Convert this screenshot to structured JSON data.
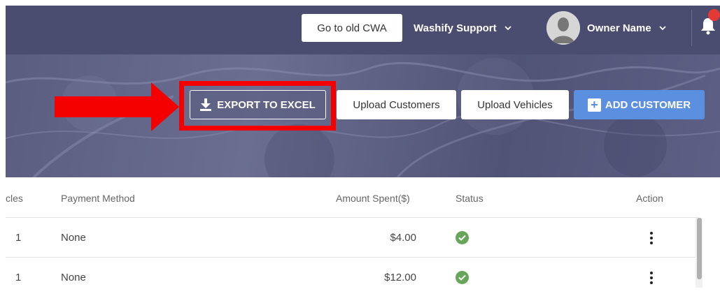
{
  "header": {
    "old_cwa_label": "Go to old CWA",
    "support_label": "Washify Support",
    "owner_label": "Owner Name"
  },
  "actions": {
    "export_label": "EXPORT TO EXCEL",
    "upload_customers_label": "Upload Customers",
    "upload_vehicles_label": "Upload Vehicles",
    "add_customer_label": "ADD CUSTOMER"
  },
  "table": {
    "columns": {
      "vehicles": "cles",
      "payment_method": "Payment Method",
      "amount_spent": "Amount Spent($)",
      "status": "Status",
      "action": "Action"
    },
    "rows": [
      {
        "vehicles": "1",
        "payment_method": "None",
        "amount_spent": "$4.00",
        "status": "active"
      },
      {
        "vehicles": "1",
        "payment_method": "None",
        "amount_spent": "$12.00",
        "status": "active"
      }
    ]
  },
  "colors": {
    "header_bg": "#4a4c70",
    "highlight": "#f40000",
    "add_button": "#5b8fe0",
    "status_ok": "#67a65a"
  }
}
